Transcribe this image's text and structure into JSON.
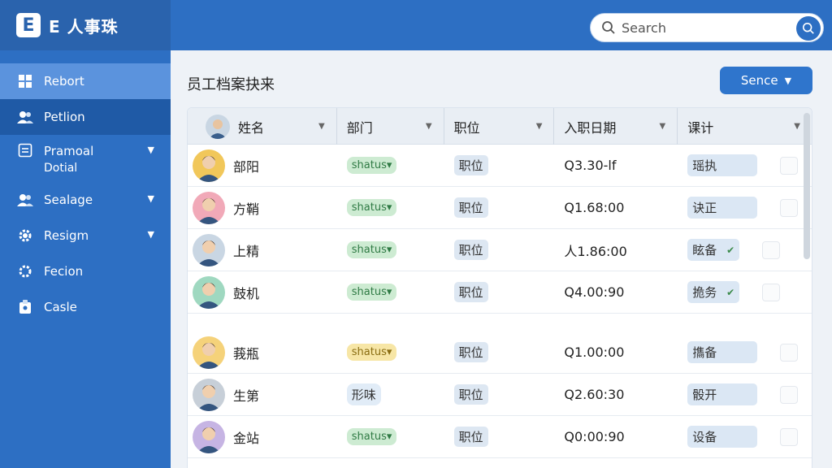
{
  "app": {
    "logo_letter": "E",
    "title": "E 人事珠"
  },
  "sidebar": {
    "items": [
      {
        "id": "report",
        "label": "Rebort",
        "icon": "grid-icon",
        "state": "active"
      },
      {
        "id": "petion",
        "label": "Petlion",
        "icon": "users-icon",
        "state": "sub-active"
      },
      {
        "id": "pramoal",
        "label": "Pramoal",
        "label2": "Dotial",
        "icon": "document-icon",
        "chevron": true
      },
      {
        "id": "sealage",
        "label": "Sealage",
        "icon": "group-icon",
        "chevron": true
      },
      {
        "id": "resign",
        "label": "Resigm",
        "icon": "settings-icon",
        "chevron": true
      },
      {
        "id": "fecion",
        "label": "Fecion",
        "icon": "gear-icon"
      },
      {
        "id": "casle",
        "label": "Casle",
        "icon": "id-card-icon"
      }
    ]
  },
  "search": {
    "placeholder": "Search"
  },
  "main": {
    "title": "员工档案抉来",
    "action_label": "Sence"
  },
  "table": {
    "headers": [
      "姓名",
      "部门",
      "职位",
      "入职日期",
      "课计"
    ],
    "rows": [
      {
        "name": "部阳",
        "dept": "shatus",
        "dept_style": "green",
        "pos": "职位",
        "date": "Q3.30-lf",
        "note": "瑶执",
        "note_check": false,
        "avatar": "#f1c75a"
      },
      {
        "name": "方鞘",
        "dept": "shatus",
        "dept_style": "green",
        "pos": "职位",
        "date": "Q1.68:00",
        "note": "诀正",
        "note_check": false,
        "avatar": "#f1a9b8"
      },
      {
        "name": "上精",
        "dept": "shatus",
        "dept_style": "green",
        "pos": "职位",
        "date": "人1.86:00",
        "note": "眩备",
        "note_check": true,
        "avatar": "#c9d6e3"
      },
      {
        "name": "鼓机",
        "dept": "shatus",
        "dept_style": "green",
        "pos": "职位",
        "date": "Q4.00:90",
        "note": "㧪务",
        "note_check": true,
        "avatar": "#9fd8c0"
      },
      {
        "name": "莪瓶",
        "dept": "shatus",
        "dept_style": "yellow",
        "pos": "职位",
        "date": "Q1.00:00",
        "note": "㩦备",
        "note_check": false,
        "avatar": "#f5d27a"
      },
      {
        "name": "生第",
        "dept": "形味",
        "dept_style": "plain",
        "pos": "职位",
        "date": "Q2.60:30",
        "note": "骰开",
        "note_check": false,
        "avatar": "#c7cfd8"
      },
      {
        "name": "金站",
        "dept": "shatus",
        "dept_style": "green",
        "pos": "职位",
        "date": "Q0:00:90",
        "note": "设备",
        "note_check": false,
        "avatar": "#c6b4e3"
      }
    ]
  },
  "colors": {
    "primary": "#2d6fc3",
    "sidebar_active": "#5b93dd",
    "status_green": "#cdebd2",
    "status_yellow": "#f7e6a6"
  }
}
